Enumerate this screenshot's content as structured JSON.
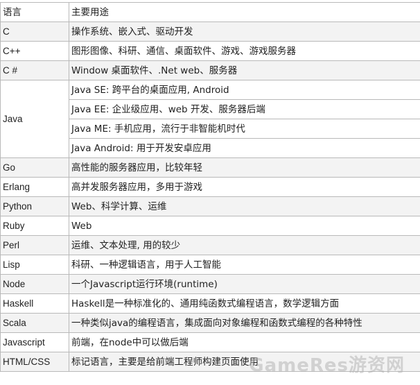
{
  "table": {
    "header": {
      "language": "语言",
      "usage": "主要用途"
    },
    "rows": [
      {
        "language": "C",
        "usages": [
          "操作系统、嵌入式、驱动开发"
        ]
      },
      {
        "language": "C++",
        "usages": [
          "图形图像、科研、通信、桌面软件、游戏、游戏服务器"
        ]
      },
      {
        "language": "C #",
        "usages": [
          "Window 桌面软件、.Net web、服务器"
        ]
      },
      {
        "language": "Java",
        "usages": [
          "Java SE: 跨平台的桌面应用, Android",
          "Java EE: 企业级应用、web 开发、服务器后端",
          "Java ME: 手机应用，流行于非智能机时代",
          "Java Android: 用于开发安卓应用"
        ]
      },
      {
        "language": "Go",
        "usages": [
          "高性能的服务器应用，比较年轻"
        ]
      },
      {
        "language": "Erlang",
        "usages": [
          "高并发服务器应用，多用于游戏"
        ]
      },
      {
        "language": "Python",
        "usages": [
          "Web、科学计算、运维"
        ]
      },
      {
        "language": "Ruby",
        "usages": [
          "Web"
        ]
      },
      {
        "language": "Perl",
        "usages": [
          "运维、文本处理, 用的较少"
        ]
      },
      {
        "language": "Lisp",
        "usages": [
          "科研、一种逻辑语言，用于人工智能"
        ]
      },
      {
        "language": "Node",
        "usages": [
          "一个Javascript运行环境(runtime)"
        ]
      },
      {
        "language": "Haskell",
        "usages": [
          "Haskell是一种标准化的、通用纯函数式编程语言，数学逻辑方面"
        ]
      },
      {
        "language": "Scala",
        "usages": [
          "一种类似java的编程语言，集成面向对象编程和函数式编程的各种特性"
        ]
      },
      {
        "language": "Javascript",
        "usages": [
          "前端，在node中可以做后端"
        ]
      },
      {
        "language": "HTML/CSS",
        "usages": [
          "标记语言，主要是给前端工程师构建页面使用"
        ]
      }
    ]
  },
  "watermark": {
    "text": "GameRes游资网"
  },
  "colors": {
    "border": "#b9b9b9",
    "row_shade": "#f3f3f3",
    "text": "#222222"
  }
}
